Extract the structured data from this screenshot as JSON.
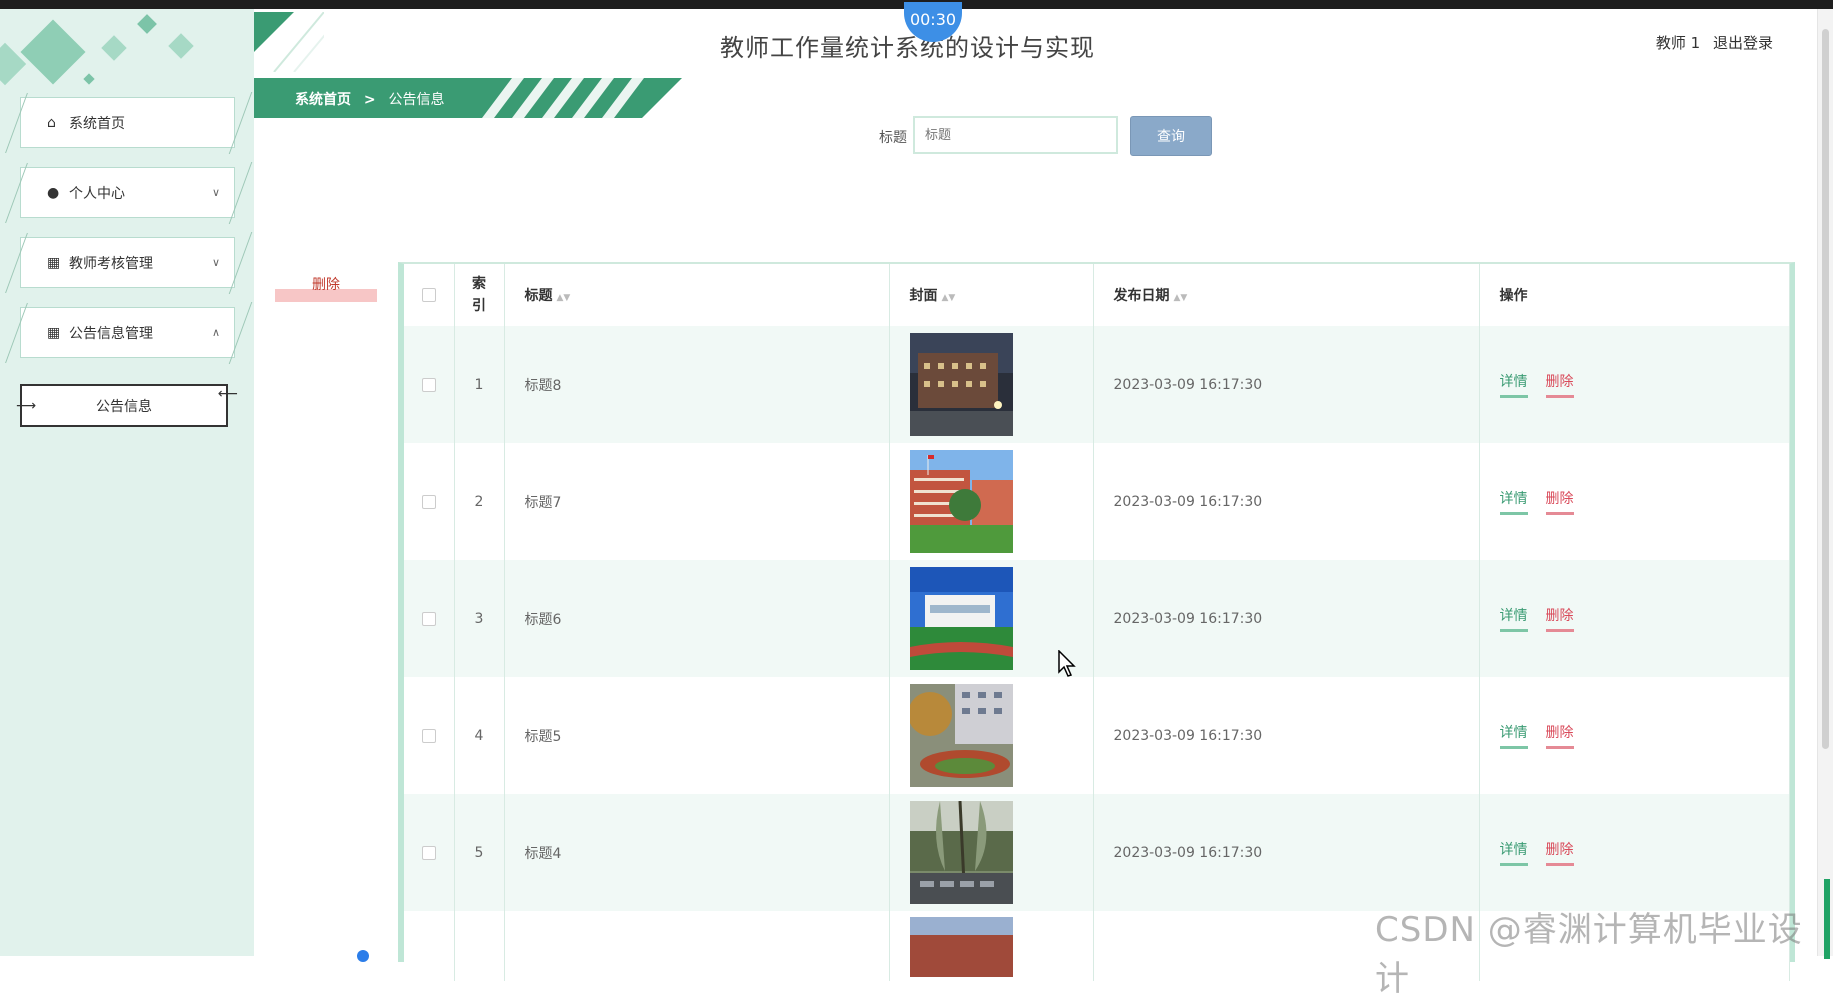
{
  "header": {
    "title": "教师工作量统计系统的设计与实现",
    "timer": "00:30",
    "user_name": "教师 1",
    "logout": "退出登录"
  },
  "sidebar": {
    "items": [
      {
        "label": "系统首页",
        "icon": "home-icon"
      },
      {
        "label": "个人中心",
        "icon": "user-icon"
      },
      {
        "label": "教师考核管理",
        "icon": "grid-icon"
      },
      {
        "label": "公告信息管理",
        "icon": "grid-icon"
      }
    ],
    "submenu_active": "公告信息"
  },
  "breadcrumb": {
    "home": "系统首页",
    "separator": ">",
    "current": "公告信息"
  },
  "search": {
    "label": "标题",
    "placeholder": "标题",
    "button": "查询"
  },
  "actions": {
    "delete": "删除"
  },
  "table": {
    "headers": {
      "index": "索引",
      "title": "标题",
      "cover": "封面",
      "date": "发布日期",
      "ops": "操作"
    },
    "rows": [
      {
        "index": "1",
        "title": "标题8",
        "date": "2023-03-09 16:17:30",
        "detail": "详情",
        "delete": "删除"
      },
      {
        "index": "2",
        "title": "标题7",
        "date": "2023-03-09 16:17:30",
        "detail": "详情",
        "delete": "删除"
      },
      {
        "index": "3",
        "title": "标题6",
        "date": "2023-03-09 16:17:30",
        "detail": "详情",
        "delete": "删除"
      },
      {
        "index": "4",
        "title": "标题5",
        "date": "2023-03-09 16:17:30",
        "detail": "详情",
        "delete": "删除"
      },
      {
        "index": "5",
        "title": "标题4",
        "date": "2023-03-09 16:17:30",
        "detail": "详情",
        "delete": "删除"
      }
    ]
  },
  "watermark": "CSDN @睿渊计算机毕业设计",
  "colors": {
    "accent": "#3a9b73",
    "sidebar_bg": "#e1f2ec",
    "danger": "#d94a5a",
    "query_btn": "#8aa9c9"
  }
}
